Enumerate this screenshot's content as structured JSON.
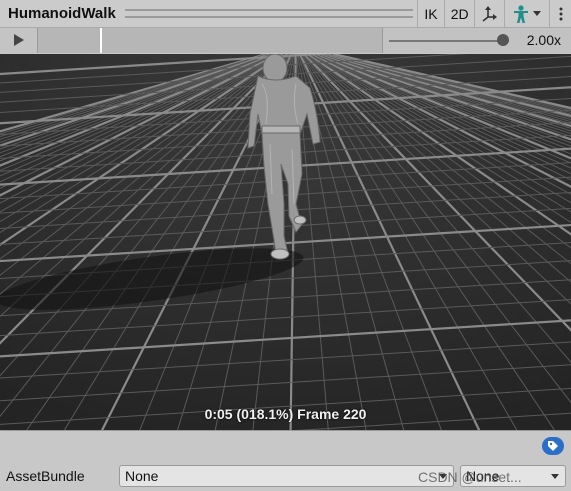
{
  "header": {
    "title": "HumanoidWalk",
    "ik_label": "IK",
    "two_d_label": "2D"
  },
  "timeline": {
    "playback_fraction": 0.181,
    "speed_label": "2.00x",
    "speed_fraction": 0.95
  },
  "viewport": {
    "frame_info": "0:05 (018.1%) Frame 220"
  },
  "bottom": {
    "asset_bundle_label": "AssetBundle",
    "bundle_value": "None",
    "variant_value": "None",
    "watermark": "CSDN @unset..."
  },
  "colors": {
    "accent": "#2a6ec8",
    "avatar_icon": "#1e8f8a",
    "viewport_bg": "#2c2c2c"
  },
  "icons": [
    "play-icon",
    "pivot-icon",
    "avatar-icon",
    "more-icon",
    "tag-icon",
    "dropdown-caret-icon"
  ]
}
